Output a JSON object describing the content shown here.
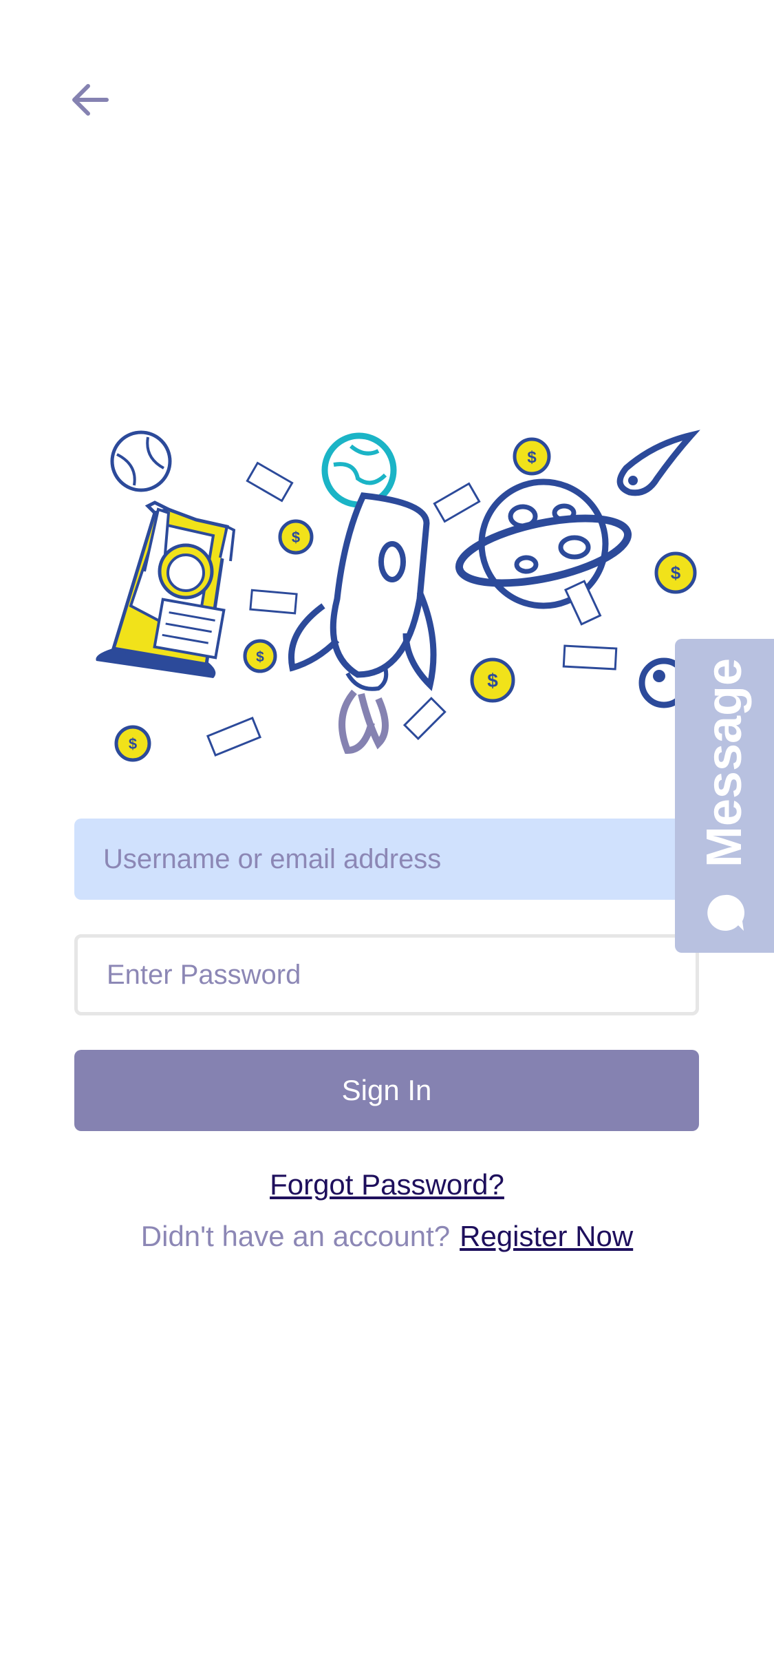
{
  "colors": {
    "accent": "#8582b1",
    "input_fill": "#d0e1fd",
    "link": "#1e0f5c",
    "muted_text": "#8c87b5",
    "message_tab": "#b8c1e0",
    "illustration_blue": "#2c4a9a",
    "illustration_yellow": "#f1e21a",
    "illustration_teal": "#1bb4c6"
  },
  "header": {
    "back_icon": "arrow-left-icon"
  },
  "hero": {
    "image": "space-rocket-illustration"
  },
  "form": {
    "username_placeholder": "Username or email address",
    "password_placeholder": "Enter Password",
    "signin_label": "Sign In",
    "forgot_label": "Forgot Password?",
    "register_prompt": "Didn't have an account?",
    "register_label": "Register Now"
  },
  "message_tab": {
    "label": "Message",
    "icon": "chat-bubble-icon"
  }
}
